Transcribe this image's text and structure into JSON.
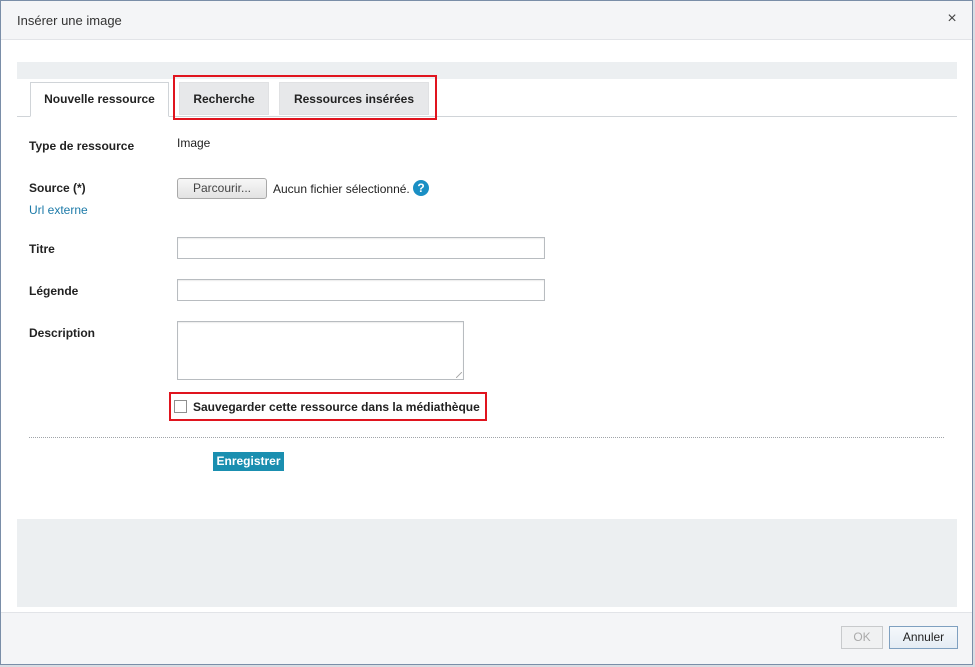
{
  "dialog": {
    "title": "Insérer une image",
    "close_symbol": "×"
  },
  "tabs": [
    {
      "label": "Nouvelle ressource",
      "active": true
    },
    {
      "label": "Recherche",
      "active": false
    },
    {
      "label": "Ressources insérées",
      "active": false
    }
  ],
  "form": {
    "type_label": "Type de ressource",
    "type_value": "Image",
    "source_label": "Source (*)",
    "external_url_link": "Url externe",
    "browse_button": "Parcourir...",
    "no_file_text": "Aucun fichier sélectionné.",
    "help_symbol": "?",
    "title_label": "Titre",
    "title_value": "",
    "caption_label": "Légende",
    "caption_value": "",
    "description_label": "Description",
    "description_value": "",
    "save_to_library_label": "Sauvegarder cette ressource dans la médiathèque",
    "save_to_library_checked": false,
    "save_button": "Enregistrer"
  },
  "footer": {
    "ok_button": "OK",
    "ok_disabled": true,
    "cancel_button": "Annuler"
  },
  "colors": {
    "accent": "#1a8fb0",
    "highlight": "#e0141e",
    "link": "#1c7aa8"
  }
}
